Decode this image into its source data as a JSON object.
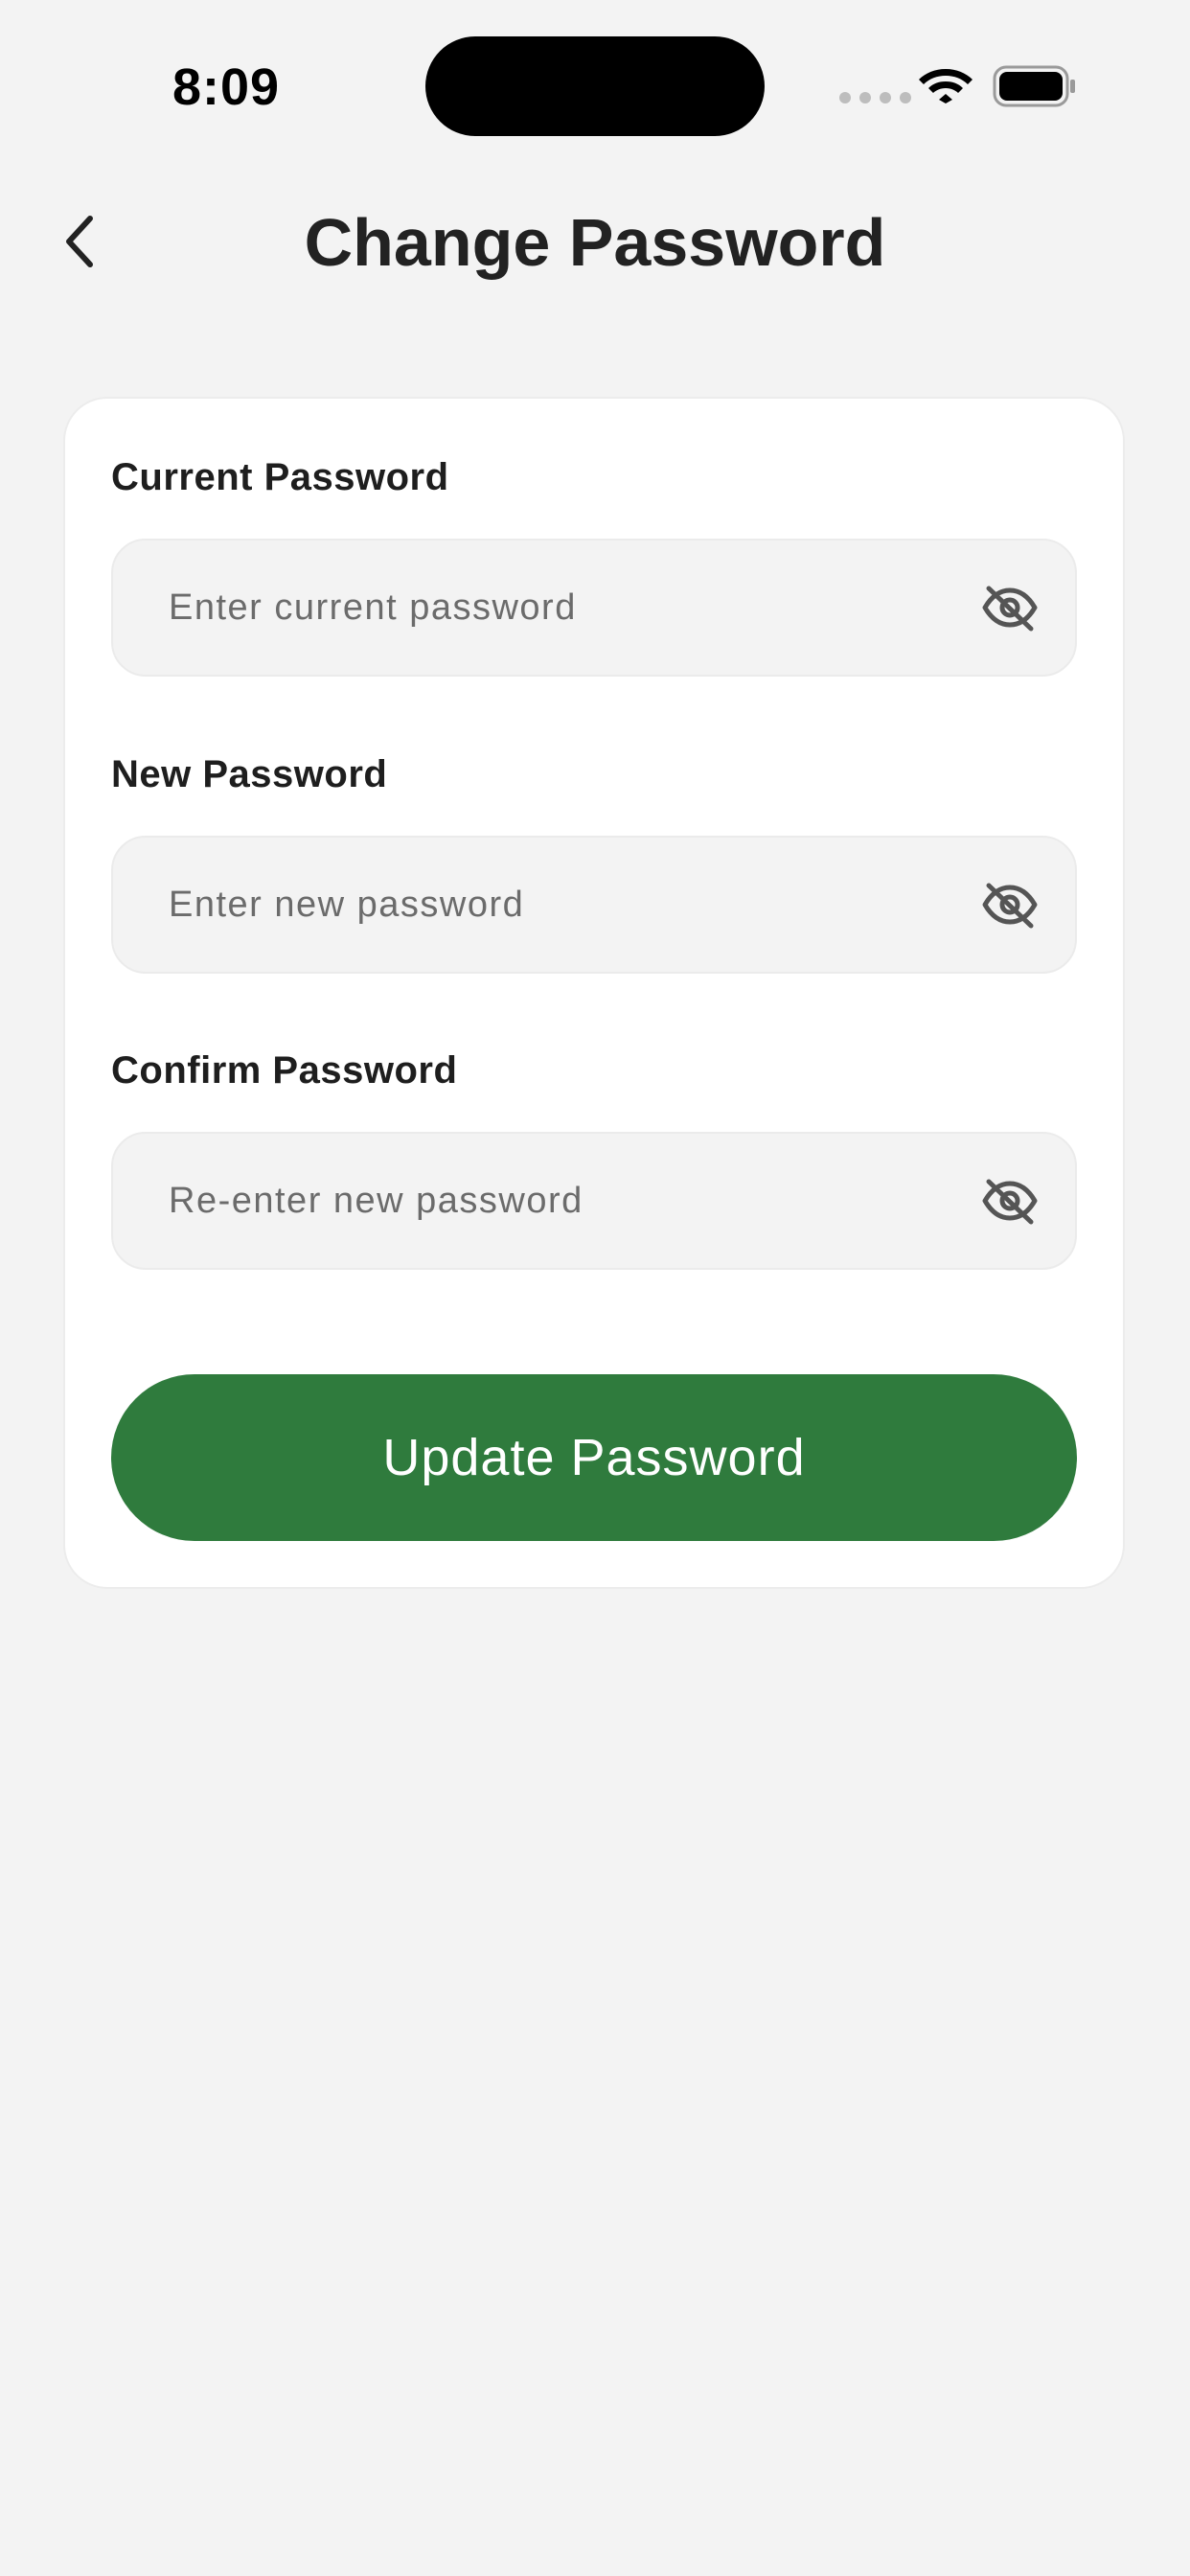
{
  "status_bar": {
    "time": "8:09"
  },
  "header": {
    "title": "Change Password",
    "back_icon": "chevron-left-icon"
  },
  "form": {
    "fields": [
      {
        "label": "Current Password",
        "placeholder": "Enter current password",
        "value": "",
        "toggle_icon": "eye-off-icon"
      },
      {
        "label": "New Password",
        "placeholder": "Enter new password",
        "value": "",
        "toggle_icon": "eye-off-icon"
      },
      {
        "label": "Confirm Password",
        "placeholder": "Re-enter new password",
        "value": "",
        "toggle_icon": "eye-off-icon"
      }
    ],
    "submit_label": "Update Password"
  },
  "colors": {
    "background": "#f3f3f3",
    "card": "#ffffff",
    "primary_button": "#2f7b3d",
    "input_background": "#f3f3f3"
  }
}
